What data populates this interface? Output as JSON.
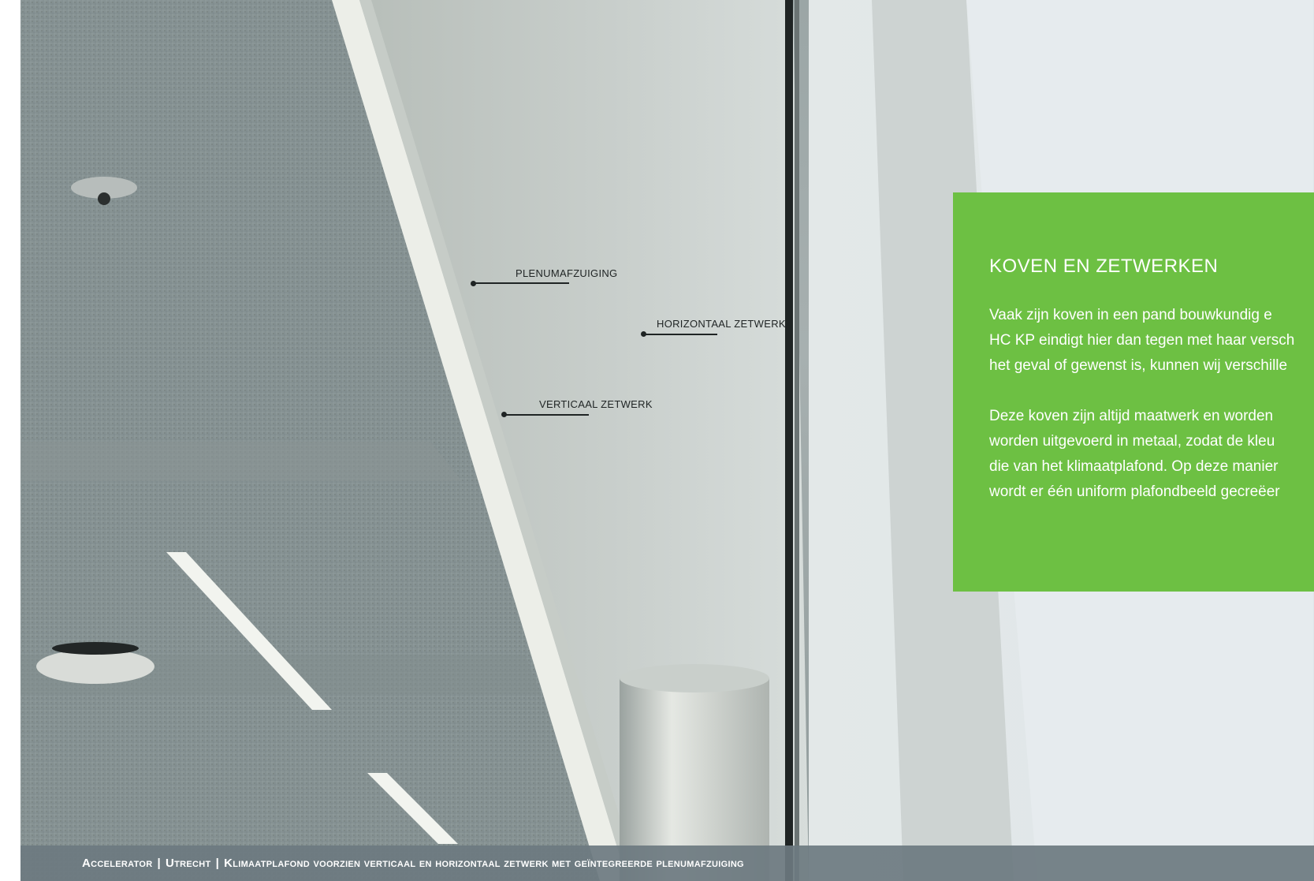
{
  "callouts": {
    "plenum": "PLENUMAFZUIGING",
    "horizontal": "HORIZONTAAL ZETWERK",
    "vertical": "VERTICAAL ZETWERK"
  },
  "panel": {
    "title": "KOVEN EN ZETWERKEN",
    "paragraph1": [
      "Vaak zijn koven in een pand bouwkundig e",
      "HC KP eindigt hier dan tegen met haar versch",
      "het geval of gewenst is, kunnen wij verschille"
    ],
    "paragraph2": [
      "Deze koven zijn altijd maatwerk en worden",
      "worden uitgevoerd in metaal, zodat de kleu",
      "die van het klimaatplafond. Op deze manier",
      "wordt er één uniform plafondbeeld gecreëer"
    ]
  },
  "caption": {
    "project": "Accelerator",
    "sep": "|",
    "city": "Utrecht",
    "description": "Klimaatplafond voorzien verticaal en horizontaal zetwerk met geïntegreerde plenumafzuiging"
  },
  "colors": {
    "panel_green": "#6dc043",
    "caption_bar": "#6c7a80",
    "label_text": "#1f2424"
  }
}
